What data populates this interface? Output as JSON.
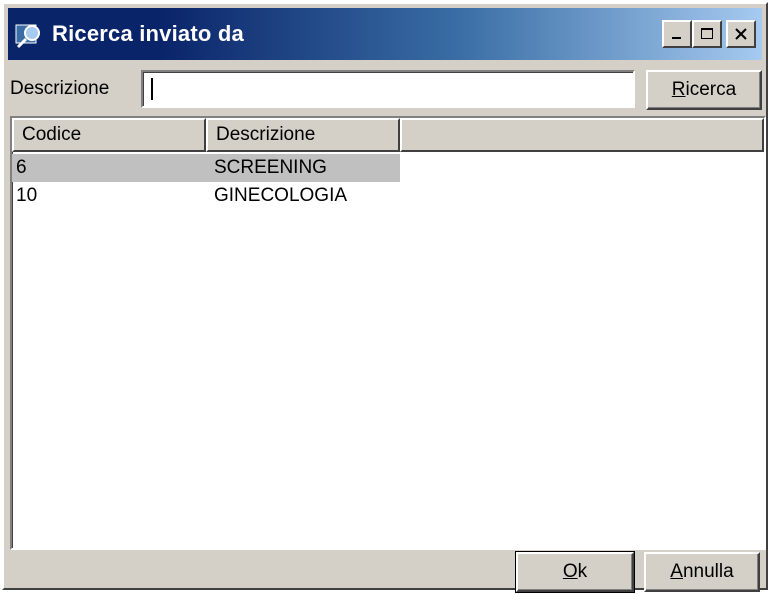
{
  "window": {
    "title": "Ricerca inviato da",
    "title_icon": "search-magnifier-icon",
    "controls": [
      "minimize-icon",
      "maximize-icon",
      "close-icon"
    ]
  },
  "search": {
    "label": "Descrizione",
    "value": "",
    "button_accel": "R",
    "button_rest": "icerca"
  },
  "table": {
    "columns": [
      "Codice",
      "Descrizione",
      ""
    ],
    "rows": [
      {
        "codice": "6",
        "descrizione": "SCREENING",
        "selected": true
      },
      {
        "codice": "10",
        "descrizione": "GINECOLOGIA",
        "selected": false
      }
    ]
  },
  "footer": {
    "ok_accel": "O",
    "ok_rest": "k",
    "cancel_accel": "A",
    "cancel_rest": "nnulla"
  },
  "colors": {
    "title_start": "#0a246a",
    "title_end": "#a6caf0",
    "face": "#d4d0c8",
    "selection": "#c0c0c0"
  }
}
